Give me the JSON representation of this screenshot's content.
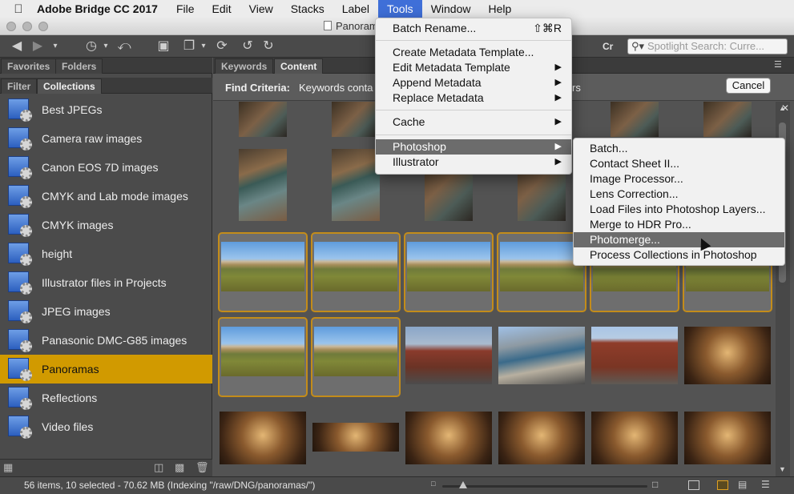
{
  "menubar": {
    "app_name": "Adobe Bridge CC 2017",
    "items": [
      "File",
      "Edit",
      "View",
      "Stacks",
      "Label",
      "Tools",
      "Window",
      "Help"
    ],
    "active": "Tools"
  },
  "window": {
    "title": "Panoramas"
  },
  "toolbar": {
    "cr_label": "Cr",
    "search_placeholder": "Spotlight Search: Curre..."
  },
  "left_panel": {
    "top_tabs": [
      "Favorites",
      "Folders"
    ],
    "sub_tabs": [
      "Filter",
      "Collections"
    ],
    "selected_collection": "Panoramas",
    "collections": [
      "Best JPEGs",
      "Camera raw images",
      "Canon EOS 7D images",
      "CMYK and Lab mode images",
      "CMYK images",
      "height",
      "Illustrator files in Projects",
      "JPEG images",
      "Panasonic DMC-G85 images",
      "Panoramas",
      "Reflections",
      "Video files"
    ]
  },
  "content_panel": {
    "tabs": [
      "Keywords",
      "Content"
    ],
    "find_criteria_label": "Find Criteria:",
    "find_criteria_value": "Keywords conta",
    "results_fragment": "rs",
    "cancel_label": "Cancel"
  },
  "tools_menu": {
    "items": [
      {
        "label": "Batch Rename...",
        "shortcut": "⇧⌘R",
        "submenu": false
      },
      {
        "label": "Create Metadata Template...",
        "submenu": false
      },
      {
        "label": "Edit Metadata Template",
        "submenu": true
      },
      {
        "label": "Append Metadata",
        "submenu": true
      },
      {
        "label": "Replace Metadata",
        "submenu": true
      },
      {
        "label": "Cache",
        "submenu": true
      },
      {
        "label": "Photoshop",
        "submenu": true,
        "highlighted": true
      },
      {
        "label": "Illustrator",
        "submenu": true
      }
    ]
  },
  "photoshop_submenu": {
    "items": [
      "Batch...",
      "Contact Sheet II...",
      "Image Processor...",
      "Lens Correction...",
      "Load Files into Photoshop Layers...",
      "Merge to HDR Pro...",
      "Photomerge...",
      "Process Collections in Photoshop"
    ],
    "highlighted": "Photomerge..."
  },
  "status": {
    "text": "56 items, 10 selected - 70.62 MB (Indexing \"/raw/DNG/panoramas/\")",
    "thumbnail_size": 0.1
  },
  "colors": {
    "accent_selected": "#d19a00",
    "menu_highlight": "#4a74d9",
    "selected_thumb_border": "#c38c1a"
  }
}
